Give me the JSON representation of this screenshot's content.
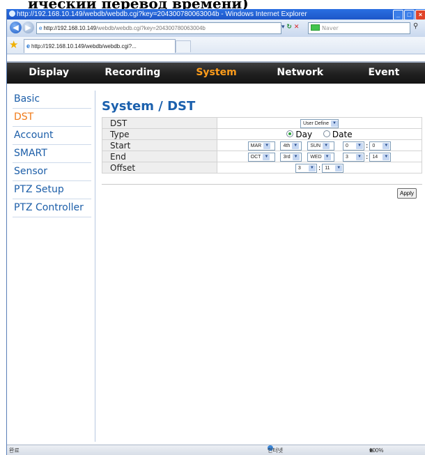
{
  "page_heading": "ический перевод времени)",
  "browser": {
    "title": "http://192.168.10.149/webdb/webdb.cgi?key=204300780063004b - Windows Internet Explorer",
    "address_host": "http://192.168.10.149",
    "address_rest": "/webdb/webdb.cgi?key=204300780063004b",
    "search_placeholder": "Naver",
    "tab_label": "http://192.168.10.149/webdb/webdb.cgi?..."
  },
  "menu": [
    "Display",
    "Recording",
    "System",
    "Network",
    "Event"
  ],
  "menu_active": "System",
  "sidebar": [
    "Basic",
    "DST",
    "Account",
    "SMART",
    "Sensor",
    "PTZ Setup",
    "PTZ Controller"
  ],
  "sidebar_active": "DST",
  "page_title": "System / DST",
  "form": {
    "dst_label": "DST",
    "dst_value": "User Define",
    "type_label": "Type",
    "type_options": [
      "Day",
      "Date"
    ],
    "type_selected": "Day",
    "start_label": "Start",
    "start": {
      "month": "MAR",
      "week": "4th",
      "day": "SUN",
      "hour": "0",
      "minute": "0"
    },
    "end_label": "End",
    "end": {
      "month": "OCT",
      "week": "3rd",
      "day": "WED",
      "hour": "3",
      "minute": "14"
    },
    "offset_label": "Offset",
    "offset": {
      "hour": "3",
      "minute": "11"
    }
  },
  "apply_label": "Apply",
  "status": {
    "left": "완료",
    "zone": "인터넷",
    "zoom": "100%"
  },
  "colors": {
    "menu_active": "#ff9c1a",
    "sidebar_active": "#f07a17",
    "link": "#1c5ea8",
    "title": "#1b60ad"
  }
}
